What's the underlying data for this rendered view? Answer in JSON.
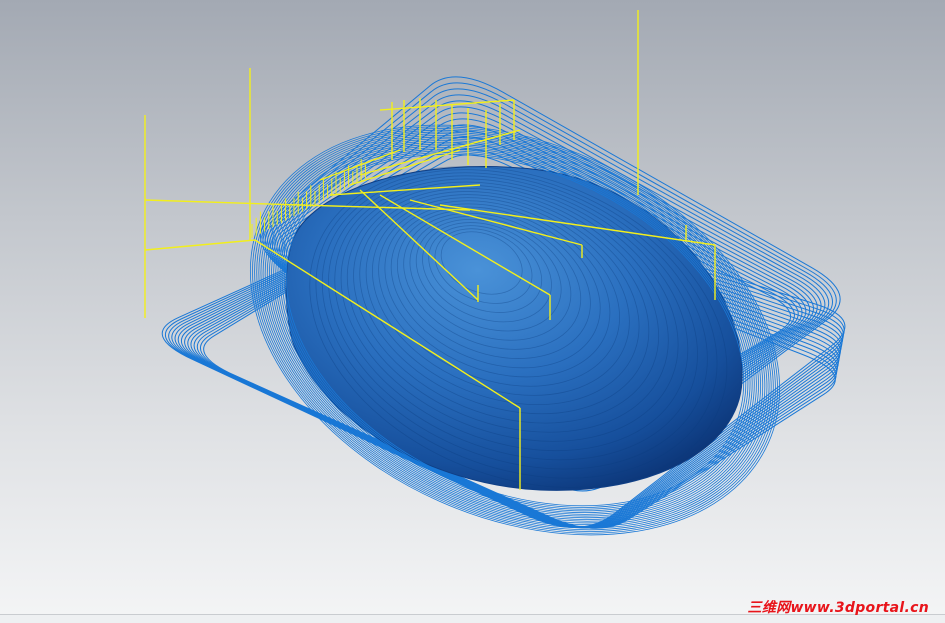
{
  "viewport": {
    "colors": {
      "background_top": "#a3a9b3",
      "background_bottom": "#f4f5f6",
      "toolpath": "#1a78d6",
      "engage_lines": "#f2ef1c",
      "dome_light": "#3f86cf",
      "dome_dark": "#0e3f86"
    },
    "objects": [
      "toolpath-contours",
      "dome-surface",
      "engage-retract-lines"
    ]
  },
  "watermark": {
    "text": "三维网www.3dportal.cn",
    "color": "#e8141a"
  }
}
